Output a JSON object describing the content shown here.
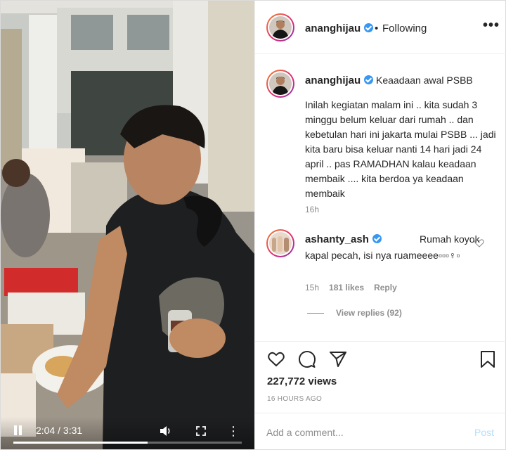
{
  "post": {
    "username": "ananghijau",
    "separator": "•",
    "follow_status": "Following",
    "more_glyph": "•••"
  },
  "caption": {
    "username": "ananghijau",
    "title": "Keaadaan awal PSBB",
    "body": "Inilah kegiatan malam ini .. kita sudah 3 minggu belum keluar dari rumah .. dan kebetulan hari ini jakarta mulai PSBB ... jadi kita baru bisa keluar nanti 14 hari jadi 24 april .. pas RAMADHAN kalau keadaan membaik .... kita berdoa ya keadaan membaik",
    "time": "16h"
  },
  "comment": {
    "username": "ashanty_ash",
    "text_line1": "Rumah koyok",
    "text_rest": "kapal pecah, isi nya ruameeee▫▫▫♀▫",
    "time": "15h",
    "likes": "181 likes",
    "reply": "Reply",
    "view_replies": "View replies (92)"
  },
  "player": {
    "time": "2:04 / 3:31",
    "progress_fraction": 0.587
  },
  "stats": {
    "views": "227,772 views",
    "date": "16 HOURS AGO"
  },
  "composer": {
    "placeholder": "Add a comment...",
    "post_label": "Post"
  },
  "icons": {
    "like": "heart-icon",
    "comment": "comment-icon",
    "share": "share-icon",
    "save": "bookmark-icon",
    "verified": "verified-badge-icon"
  },
  "colors": {
    "verified": "#3897f0",
    "post_disabled": "#b2dffc",
    "muted": "#8e8e8e"
  }
}
